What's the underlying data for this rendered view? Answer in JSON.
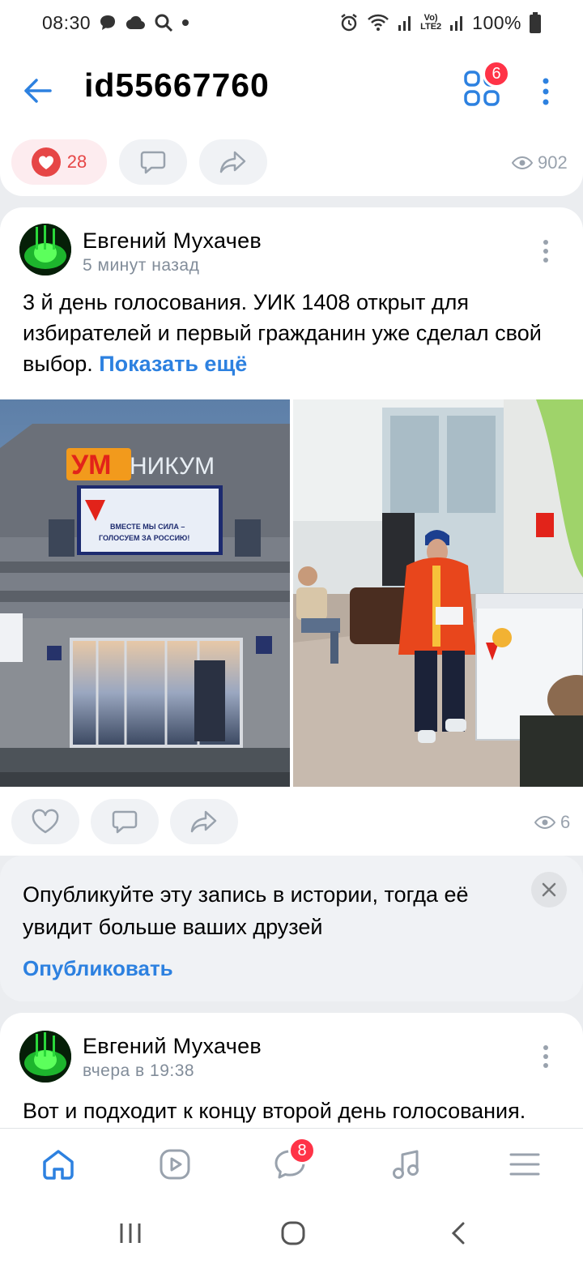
{
  "status_bar": {
    "time": "08:30",
    "battery": "100%",
    "network_top": "Vo)",
    "network_bottom": "LTE2",
    "icons": [
      "chat-icon",
      "cloud-icon",
      "search-icon",
      "dot-icon",
      "alarm-icon",
      "wifi-icon",
      "signal-icon",
      "battery-icon"
    ]
  },
  "header": {
    "title": "id55667760",
    "services_badge": "6",
    "icons": [
      "back-arrow-icon",
      "services-grid-icon",
      "more-vertical-icon"
    ]
  },
  "previous_post": {
    "likes": "28",
    "views": "902"
  },
  "post": {
    "author": "Евгений Мухачев",
    "time": "5 минут назад",
    "text": "3 й день голосования. УИК 1408 открыт для избирателей и первый гражданин уже сделал свой выбор.",
    "show_more": "Показать ещё",
    "views": "6",
    "photos": [
      {
        "name": "building-photo",
        "sign_text": "УМНИКУМ",
        "banner_text": "ВМЕСТЕ МЫ СИЛА – ГОЛОСУЕМ ЗА РОССИЮ!"
      },
      {
        "name": "polling-station-photo"
      }
    ]
  },
  "story_banner": {
    "text": "Опубликуйте эту запись в истории, тогда её увидит больше ваших друзей",
    "action": "Опубликовать"
  },
  "post2": {
    "author": "Евгений Мухачев",
    "time": "вчера в 19:38",
    "text": "Вот и подходит к концу второй день голосования."
  },
  "tabbar": {
    "tabs": [
      "home",
      "video",
      "messenger",
      "music",
      "menu"
    ],
    "messenger_badge": "8"
  },
  "colors": {
    "accent": "#2d81e0",
    "like": "#e64646",
    "badge": "#ff3347",
    "muted": "#818c99",
    "background": "#ebedf0"
  }
}
